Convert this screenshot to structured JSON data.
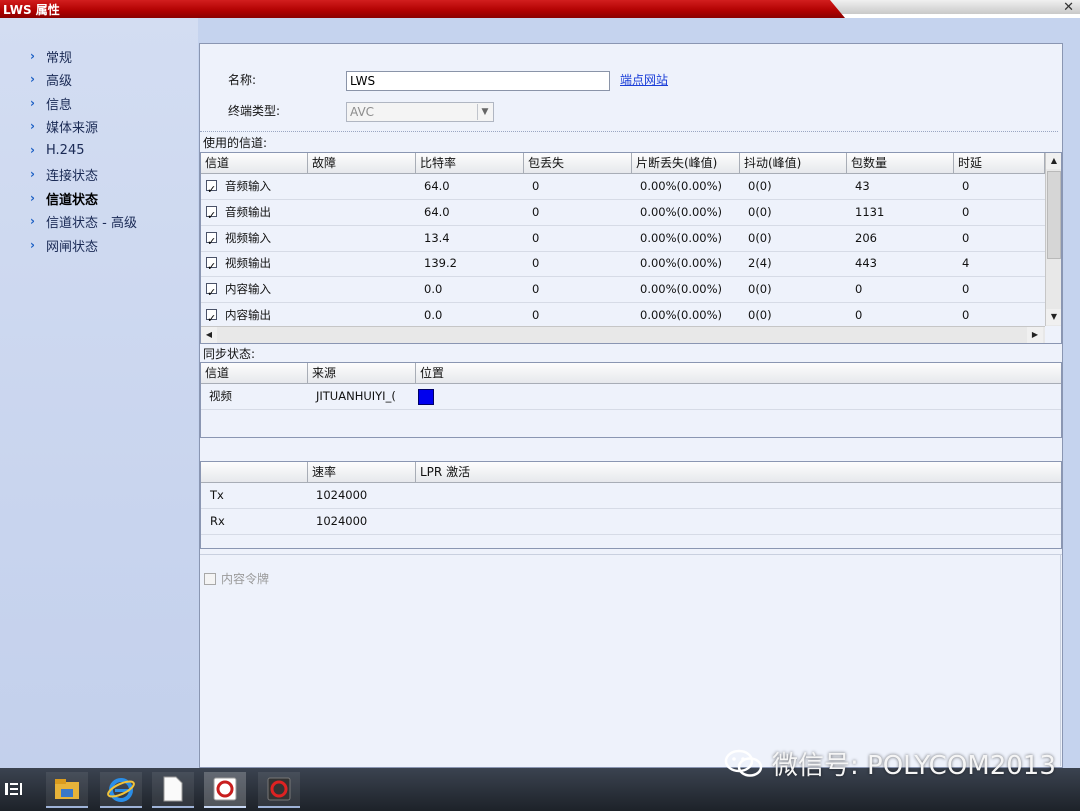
{
  "window": {
    "title": "LWS 属性",
    "close_glyph": "✕"
  },
  "sidebar": {
    "items": [
      {
        "label": "常规",
        "active": false
      },
      {
        "label": "高级",
        "active": false
      },
      {
        "label": "信息",
        "active": false
      },
      {
        "label": "媒体来源",
        "active": false
      },
      {
        "label": "H.245",
        "active": false
      },
      {
        "label": "连接状态",
        "active": false
      },
      {
        "label": "信道状态",
        "active": true
      },
      {
        "label": "信道状态 - 高级",
        "active": false
      },
      {
        "label": "网闸状态",
        "active": false
      }
    ]
  },
  "form": {
    "name_label": "名称:",
    "name_value": "LWS",
    "web_link": "端点网站",
    "type_label": "终端类型:",
    "type_value": "AVC"
  },
  "channels": {
    "section_title": "使用的信道:",
    "columns": [
      "信道",
      "故障",
      "比特率",
      "包丢失",
      "片断丢失(峰值)",
      "抖动(峰值)",
      "包数量",
      "时延"
    ],
    "rows": [
      {
        "checked": true,
        "channel": "音频输入",
        "fault": "",
        "bitrate": "64.0",
        "loss": "0",
        "frag": "0.00%(0.00%)",
        "jitter": "0(0)",
        "packets": "43",
        "delay": "0"
      },
      {
        "checked": true,
        "channel": "音频输出",
        "fault": "",
        "bitrate": "64.0",
        "loss": "0",
        "frag": "0.00%(0.00%)",
        "jitter": "0(0)",
        "packets": "1131",
        "delay": "0"
      },
      {
        "checked": true,
        "channel": "视频输入",
        "fault": "",
        "bitrate": "13.4",
        "loss": "0",
        "frag": "0.00%(0.00%)",
        "jitter": "0(0)",
        "packets": "206",
        "delay": "0"
      },
      {
        "checked": true,
        "channel": "视频输出",
        "fault": "",
        "bitrate": "139.2",
        "loss": "0",
        "frag": "0.00%(0.00%)",
        "jitter": "2(4)",
        "packets": "443",
        "delay": "4"
      },
      {
        "checked": true,
        "channel": "内容输入",
        "fault": "",
        "bitrate": "0.0",
        "loss": "0",
        "frag": "0.00%(0.00%)",
        "jitter": "0(0)",
        "packets": "0",
        "delay": "0"
      },
      {
        "checked": true,
        "channel": "内容输出",
        "fault": "",
        "bitrate": "0.0",
        "loss": "0",
        "frag": "0.00%(0.00%)",
        "jitter": "0(0)",
        "packets": "0",
        "delay": "0"
      }
    ]
  },
  "sync": {
    "section_title": "同步状态:",
    "columns": [
      "信道",
      "来源",
      "位置"
    ],
    "rows": [
      {
        "channel": "视频",
        "source": "JITUANHUIYI_(",
        "position_color": "#0000ee"
      }
    ]
  },
  "rate": {
    "columns": [
      "",
      "速率",
      "LPR 激活"
    ],
    "rows": [
      {
        "name": "Tx",
        "rate": "1024000",
        "lpr": ""
      },
      {
        "name": "Rx",
        "rate": "1024000",
        "lpr": ""
      }
    ]
  },
  "content_token": {
    "label": "内容令牌",
    "checked": false,
    "enabled": false
  },
  "taskbar": {
    "apps": [
      "start-icon",
      "file-explorer-icon",
      "internet-explorer-icon",
      "document-icon",
      "polycom-app-icon",
      "polycom-app-icon-2"
    ]
  },
  "watermark": {
    "text": "微信号: POLYCOM2013"
  }
}
